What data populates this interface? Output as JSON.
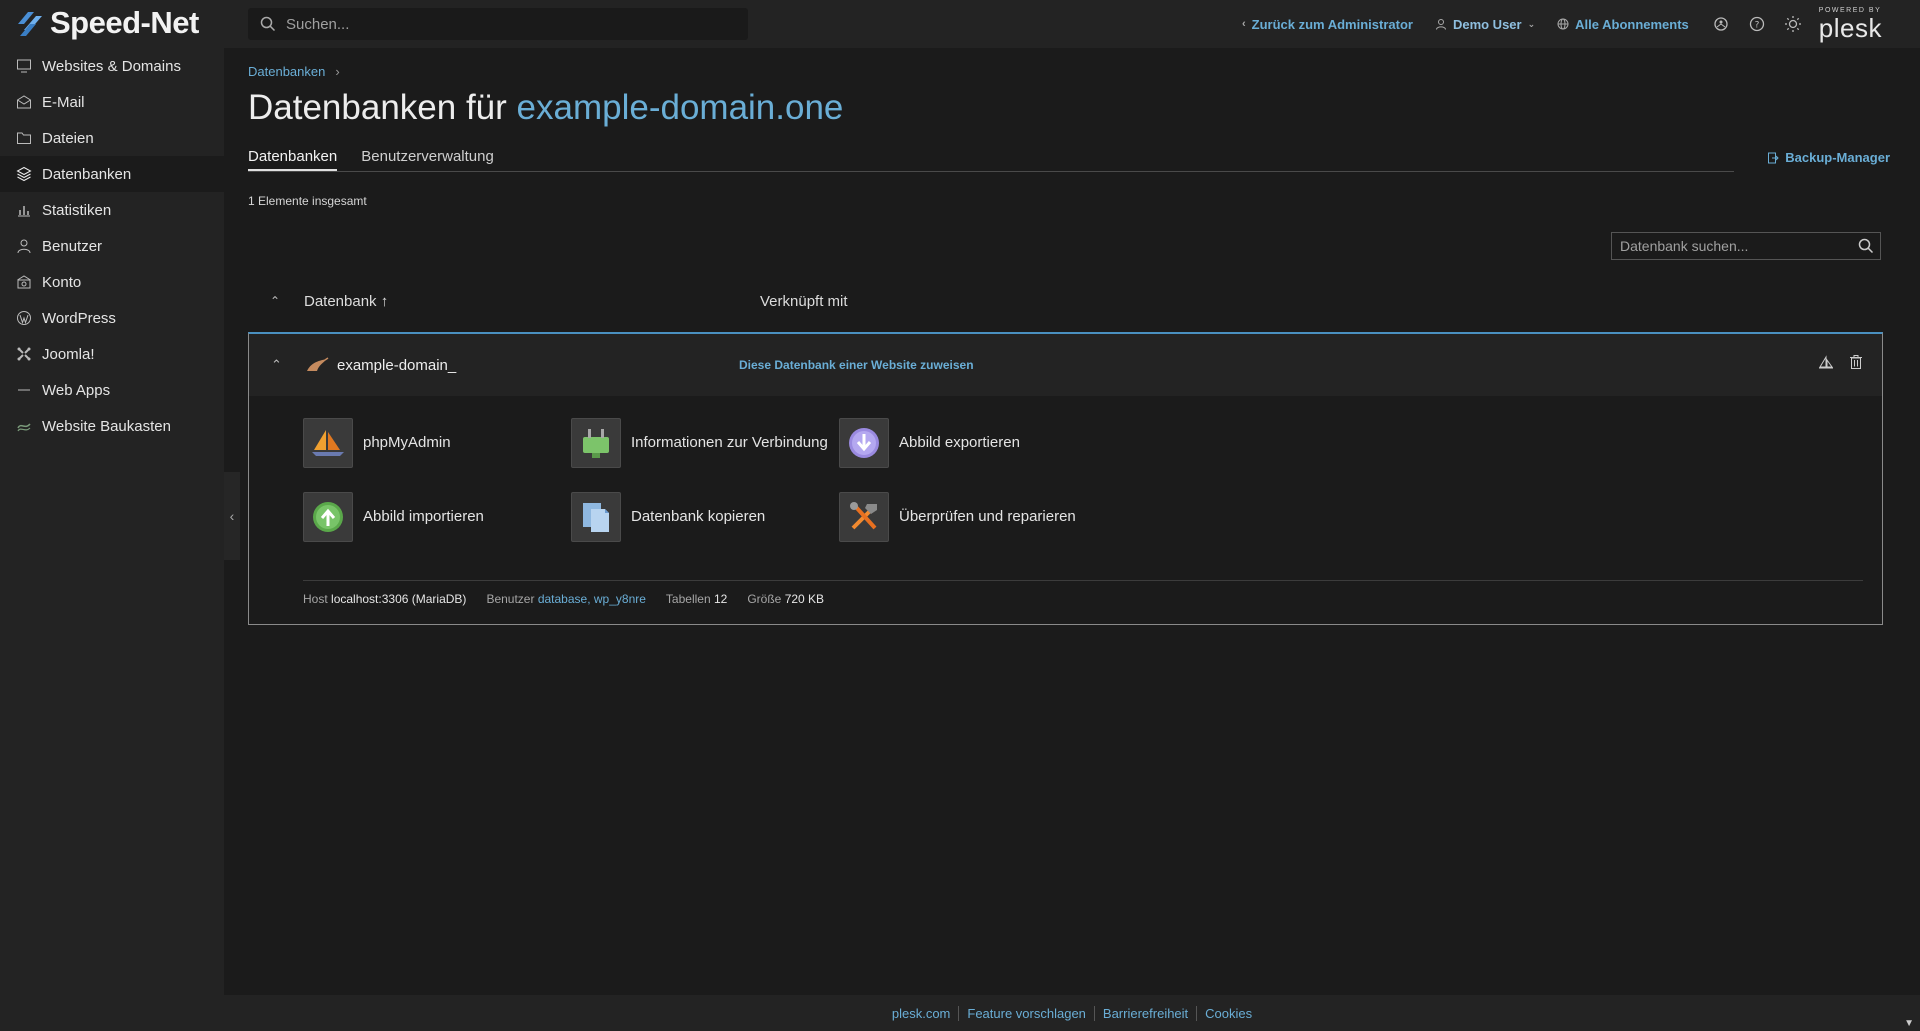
{
  "brand": {
    "name": "Speed-Net",
    "powered_by": "POWERED BY",
    "plesk": "plesk"
  },
  "search": {
    "placeholder": "Suchen..."
  },
  "topnav": {
    "back_admin": "Zurück zum Administrator",
    "user": "Demo User",
    "subscriptions": "Alle Abonnements"
  },
  "sidebar": {
    "items": [
      {
        "label": "Websites & Domains",
        "icon": "monitor-icon"
      },
      {
        "label": "E-Mail",
        "icon": "mail-icon"
      },
      {
        "label": "Dateien",
        "icon": "folder-icon"
      },
      {
        "label": "Datenbanken",
        "icon": "layers-icon",
        "active": true
      },
      {
        "label": "Statistiken",
        "icon": "bar-chart-icon"
      },
      {
        "label": "Benutzer",
        "icon": "user-icon"
      },
      {
        "label": "Konto",
        "icon": "account-icon"
      },
      {
        "label": "WordPress",
        "icon": "wordpress-icon"
      },
      {
        "label": "Joomla!",
        "icon": "joomla-icon"
      },
      {
        "label": "Web Apps",
        "icon": "apps-icon"
      },
      {
        "label": "Website Baukasten",
        "icon": "builder-icon"
      }
    ]
  },
  "page": {
    "breadcrumb": "Datenbanken",
    "title_prefix": "Datenbanken für",
    "title_domain": "example-domain.one",
    "tabs": [
      "Datenbanken",
      "Benutzerverwaltung"
    ],
    "backup_manager": "Backup-Manager",
    "item_count": "1 Elemente insgesamt",
    "db_search_placeholder": "Datenbank suchen..."
  },
  "table": {
    "col_database": "Datenbank ↑",
    "col_linked": "Verknüpft mit",
    "rows": [
      {
        "name": "example-domain_",
        "assign_link": "Diese Datenbank einer Website zuweisen",
        "tools": [
          "phpMyAdmin",
          "Informationen zur Verbindung",
          "Abbild exportieren",
          "Abbild importieren",
          "Datenbank kopieren",
          "Überprüfen und reparieren"
        ],
        "meta": {
          "host_label": "Host",
          "host_value": "localhost:3306 (MariaDB)",
          "user_label": "Benutzer",
          "user_1": "database",
          "user_sep": ",",
          "user_2": "wp_y8nre",
          "tables_label": "Tabellen",
          "tables_value": "12",
          "size_label": "Größe",
          "size_value": "720 KB"
        }
      }
    ]
  },
  "footer": [
    "plesk.com",
    "Feature vorschlagen",
    "Barrierefreiheit",
    "Cookies"
  ],
  "colors": {
    "accent": "#6aaed6",
    "bg": "#1b1b1b",
    "panel": "#232323",
    "row_border": "#4a90c0"
  }
}
